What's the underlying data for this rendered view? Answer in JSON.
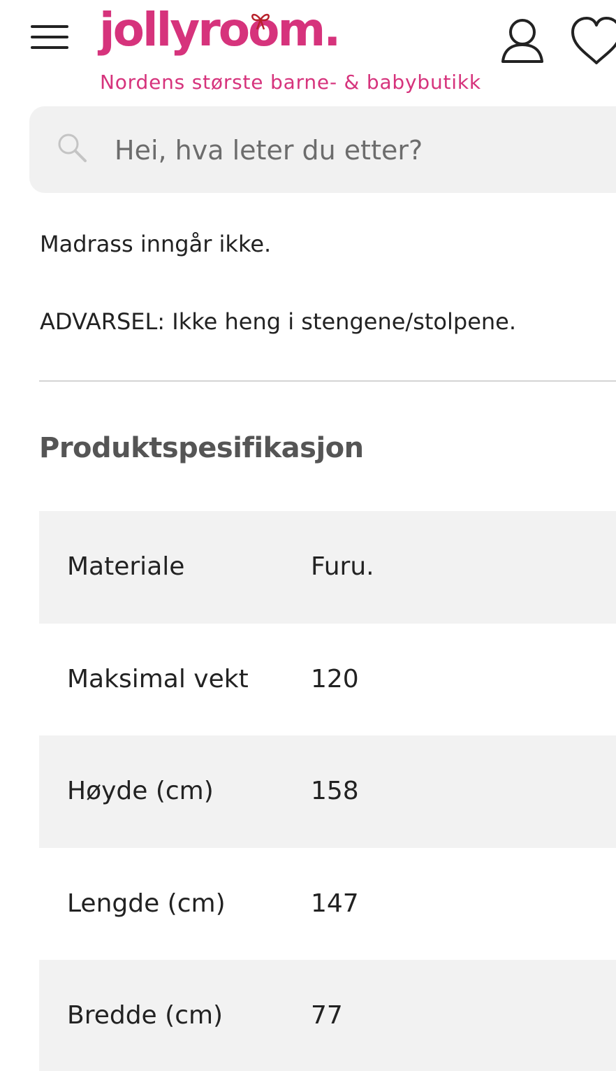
{
  "header": {
    "logo_text": "jollyroom.",
    "tagline": "Nordens største barne- & babybutikk",
    "brand_color": "#d6337c"
  },
  "search": {
    "placeholder": "Hei, hva leter du etter?",
    "icon": "search-icon"
  },
  "description": {
    "line1": "Madrass inngår ikke.",
    "line2": "ADVARSEL: Ikke heng i stengene/stolpene."
  },
  "specs": {
    "title": "Produktspesifikasjon",
    "rows": [
      {
        "label": "Materiale",
        "value": "Furu."
      },
      {
        "label": "Maksimal vekt",
        "value": "120"
      },
      {
        "label": "Høyde (cm)",
        "value": "158"
      },
      {
        "label": "Lengde (cm)",
        "value": "147"
      },
      {
        "label": "Bredde (cm)",
        "value": "77"
      }
    ]
  },
  "icons": {
    "menu": "hamburger-menu-icon",
    "user": "user-account-icon",
    "wishlist": "heart-icon"
  }
}
